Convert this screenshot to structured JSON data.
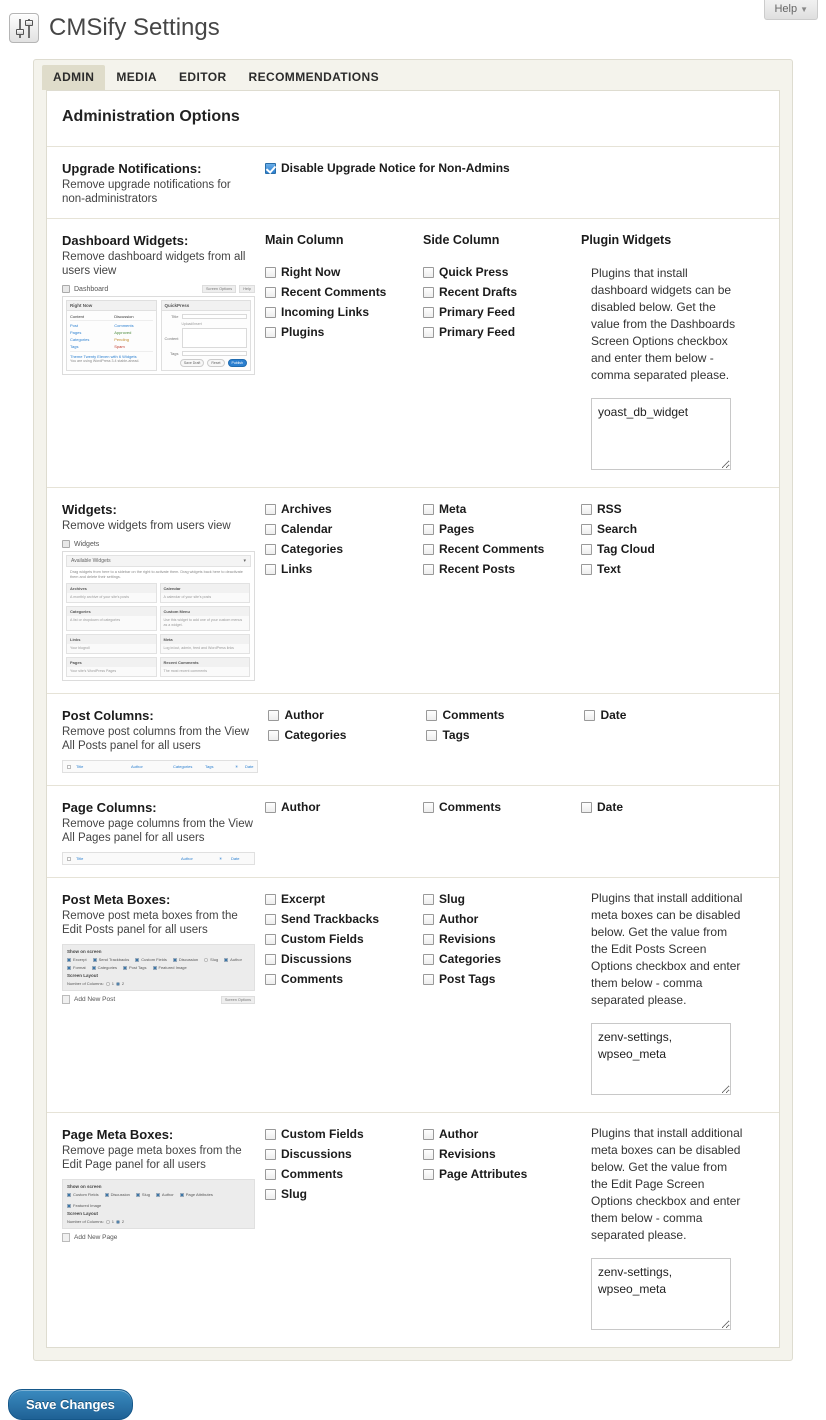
{
  "header": {
    "title": "CMSify Settings",
    "icon": "sliders-icon",
    "help_label": "Help",
    "help_caret": "▼"
  },
  "tabs": [
    {
      "label": "ADMIN",
      "active": true
    },
    {
      "label": "MEDIA",
      "active": false
    },
    {
      "label": "EDITOR",
      "active": false
    },
    {
      "label": "RECOMMENDATIONS",
      "active": false
    }
  ],
  "panel": {
    "heading": "Administration Options"
  },
  "sections": {
    "upgrade": {
      "title": "Upgrade Notifications:",
      "desc": "Remove upgrade notifications for non-administrators",
      "checkbox": {
        "label": "Disable Upgrade Notice for Non-Admins",
        "checked": true
      }
    },
    "dashboard_widgets": {
      "title": "Dashboard Widgets:",
      "desc": "Remove dashboard widgets from all users view",
      "col1_head": "Main Column",
      "col2_head": "Side Column",
      "col3_head": "Plugin Widgets",
      "main_column": [
        "Right Now",
        "Recent Comments",
        "Incoming Links",
        "Plugins"
      ],
      "side_column": [
        "Quick Press",
        "Recent Drafts",
        "Primary Feed",
        "Primary Feed"
      ],
      "note": "Plugins that install dashboard widgets can be disabled below. Get the value from the Dashboards Screen Options checkbox and enter them below - comma separated please.",
      "textarea_value": "yoast_db_widget",
      "thumb": {
        "title": "Dashboard",
        "panel1": "Right Now",
        "panel2": "QuickPress",
        "col_a": "Content",
        "col_b": "Discussion",
        "rows": [
          {
            "left": "Post",
            "right": "Comments"
          },
          {
            "left": "Pages",
            "right": "Approved"
          },
          {
            "left": "Categories",
            "right": "Pending"
          },
          {
            "left": "Tags",
            "right": "Spam"
          }
        ],
        "footer1": "Theme Twenty Eleven with 6 Widgets",
        "footer2": "You are using WordPress 3.4 stable-ahead.",
        "q_title": "Title",
        "q_content": "Content",
        "q_tags": "Tags",
        "q_upload": "Upload/Insert",
        "btn_save": "Save Draft",
        "btn_reset": "Reset",
        "btn_publish": "Publish",
        "screen_options": "Screen Options",
        "help": "Help"
      }
    },
    "widgets": {
      "title": "Widgets:",
      "desc": "Remove widgets from users view",
      "col1": [
        "Archives",
        "Calendar",
        "Categories",
        "Links"
      ],
      "col2": [
        "Meta",
        "Pages",
        "Recent Comments",
        "Recent Posts"
      ],
      "col3": [
        "RSS",
        "Search",
        "Tag Cloud",
        "Text"
      ],
      "thumb": {
        "title": "Widgets",
        "bar": "Available Widgets",
        "desc": "Drag widgets from here to a sidebar on the right to activate them. Drag widgets back here to deactivate them and delete their settings.",
        "cards": [
          {
            "name": "Archives",
            "desc": "A monthly archive of your site's posts"
          },
          {
            "name": "Calendar",
            "desc": "A calendar of your site's posts"
          },
          {
            "name": "Categories",
            "desc": "A list or dropdown of categories"
          },
          {
            "name": "Custom Menu",
            "desc": "Use this widget to add one of your custom menus as a widget."
          },
          {
            "name": "Links",
            "desc": "Your blogroll"
          },
          {
            "name": "Meta",
            "desc": "Log in/out, admin, feed and WordPress links"
          },
          {
            "name": "Pages",
            "desc": "Your site's WordPress Pages"
          },
          {
            "name": "Recent Comments",
            "desc": "The most recent comments"
          }
        ]
      }
    },
    "post_columns": {
      "title": "Post Columns:",
      "desc": "Remove post columns from the View All Posts panel for all users",
      "col1": [
        "Author",
        "Categories"
      ],
      "col2": [
        "Comments",
        "Tags"
      ],
      "col3": [
        "Date"
      ],
      "thumb_columns": [
        "Title",
        "Author",
        "Categories",
        "Tags",
        "Date"
      ]
    },
    "page_columns": {
      "title": "Page Columns:",
      "desc": "Remove page columns from the View All Pages panel for all users",
      "col1": [
        "Author"
      ],
      "col2": [
        "Comments"
      ],
      "col3": [
        "Date"
      ],
      "thumb_columns": [
        "Title",
        "Author",
        "Date"
      ]
    },
    "post_meta_boxes": {
      "title": "Post Meta Boxes:",
      "desc": "Remove post meta boxes from the Edit Posts panel for all users",
      "col1": [
        "Excerpt",
        "Send Trackbacks",
        "Custom Fields",
        "Discussions",
        "Comments"
      ],
      "col2": [
        "Slug",
        "Author",
        "Revisions",
        "Categories",
        "Post Tags"
      ],
      "note": "Plugins that install additional meta boxes can be disabled below. Get the value from the Edit Posts Screen Options checkbox and enter them below - comma separated please.",
      "textarea_value": "zenv-settings, wpseo_meta",
      "thumb": {
        "show_on_screen": "Show on screen",
        "items_row1": [
          "Excerpt",
          "Send Trackbacks",
          "Custom Fields",
          "Discussion",
          "Slug",
          "Author"
        ],
        "items_row2": [
          "Format",
          "Categories",
          "Post Tags",
          "Featured Image"
        ],
        "screen_layout": "Screen Layout",
        "number_of_columns": "Number of Columns:",
        "col_opt1": "1",
        "col_opt2": "2",
        "footer": "Add New Post",
        "screen_options": "Screen Options"
      }
    },
    "page_meta_boxes": {
      "title": "Page Meta Boxes:",
      "desc": "Remove page meta boxes from the Edit Page panel for all users",
      "col1": [
        "Custom Fields",
        "Discussions",
        "Comments",
        "Slug"
      ],
      "col2": [
        "Author",
        "Revisions",
        "Page Attributes"
      ],
      "note": "Plugins that install additional meta boxes can be disabled below. Get the value from the Edit Page Screen Options checkbox and enter them below - comma separated please.",
      "textarea_value": "zenv-settings, wpseo_meta",
      "thumb": {
        "show_on_screen": "Show on screen",
        "items_row1": [
          "Custom Fields",
          "Discussion",
          "Slug",
          "Author",
          "Page Attributes",
          "Featured Image"
        ],
        "screen_layout": "Screen Layout",
        "number_of_columns": "Number of Columns:",
        "col_opt1": "1",
        "col_opt2": "2",
        "footer": "Add New Page"
      }
    }
  },
  "footer": {
    "save_label": "Save Changes"
  },
  "colors": {
    "accent": "#2a7fd0",
    "panel_bg": "#f4f3ec",
    "tab_active": "#dfdcca",
    "save_button": "#1f6195"
  }
}
